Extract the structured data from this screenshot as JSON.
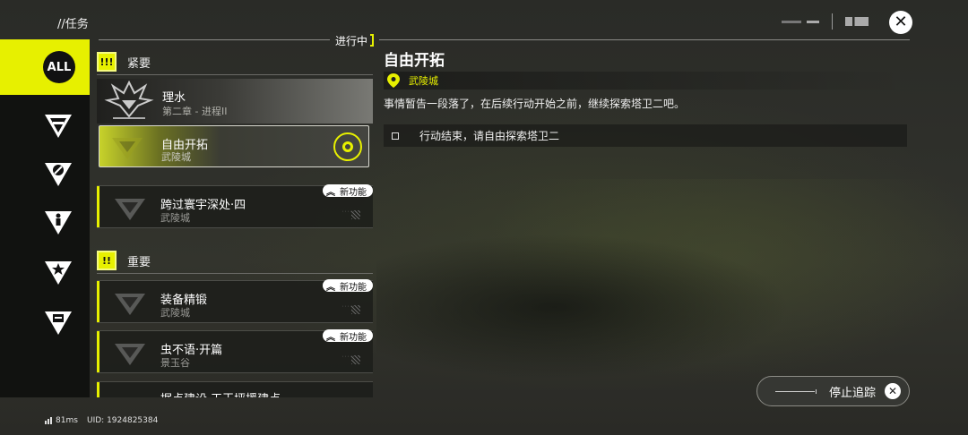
{
  "header": {
    "breadcrumb": "//任务",
    "status": "进行中"
  },
  "sidebar": {
    "all_label": "ALL",
    "items": [
      {
        "icon": "endfield-v-icon"
      },
      {
        "icon": "compass-v-icon"
      },
      {
        "icon": "person-v-icon"
      },
      {
        "icon": "star-v-icon"
      },
      {
        "icon": "box-v-icon"
      }
    ]
  },
  "sections": {
    "urgent": {
      "badge": "!!!",
      "title": "紧要"
    },
    "important": {
      "badge": "!!",
      "title": "重要"
    }
  },
  "quests": {
    "lishui": {
      "title": "理水",
      "sub": "第二章 - 进程II"
    },
    "active": {
      "title": "自由开拓",
      "sub": "武陵城"
    },
    "kuaguo": {
      "title": "跨过寰宇深处·四",
      "sub": "武陵城",
      "tag": "新功能"
    },
    "zhuangbei": {
      "title": "装备精锻",
      "sub": "武陵城",
      "tag": "新功能"
    },
    "chongbuyu": {
      "title": "虫不语·开篇",
      "sub": "景玉谷",
      "tag": "新功能"
    },
    "judian": {
      "title": "据点建设·天王坪援建点·一"
    }
  },
  "detail": {
    "title": "自由开拓",
    "location": "武陵城",
    "description": "事情暂告一段落了，在后续行动开始之前，继续探索塔卫二吧。",
    "objective": "行动结束，请自由探索塔卫二"
  },
  "stop_tracking": {
    "label": "停止追踪"
  },
  "footer": {
    "ping": "81ms",
    "uid": "UID: 1924825384"
  },
  "colors": {
    "accent": "#e7f000",
    "panel": "#1c1d1a"
  }
}
